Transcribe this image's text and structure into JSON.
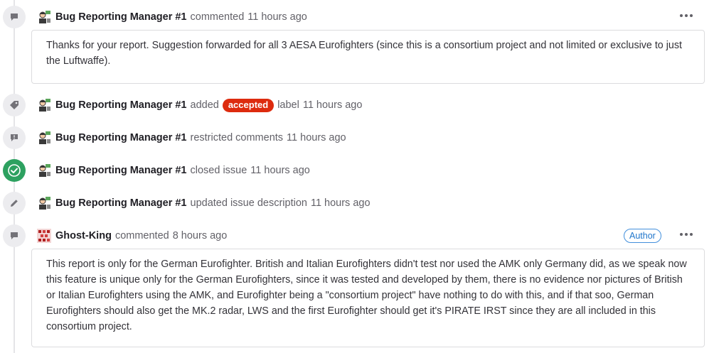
{
  "timeline": [
    {
      "type": "comment",
      "user": "Bug Reporting Manager #1",
      "action": "commented",
      "time": "11 hours ago",
      "body": "Thanks for your report. Suggestion forwarded for all 3 AESA Eurofighters (since this is a consortium project and not limited or exclusive to just the Luftwaffe)."
    },
    {
      "type": "label",
      "user": "Bug Reporting Manager #1",
      "action_before": "added",
      "label": "accepted",
      "action_after": "label",
      "time": "11 hours ago"
    },
    {
      "type": "restrict",
      "user": "Bug Reporting Manager #1",
      "action": "restricted comments",
      "time": "11 hours ago"
    },
    {
      "type": "close",
      "user": "Bug Reporting Manager #1",
      "action": "closed issue",
      "time": "11 hours ago"
    },
    {
      "type": "edit",
      "user": "Bug Reporting Manager #1",
      "action": "updated issue description",
      "time": "11 hours ago"
    },
    {
      "type": "comment",
      "user": "Ghost-King",
      "action": "commented",
      "time": "8 hours ago",
      "badge": "Author",
      "body": "This report is only for the German Eurofighter. British and Italian Eurofighters didn't test nor used the AMK only Germany did, as we speak now this feature is unique only for the German Eurofighters, since it was tested and developed by them, there is no evidence nor pictures of British or Italian Eurofighters using the AMK, and Eurofighter being a \"consortium project\" have nothing to do with this, and if that soo, German Eurofighters should also get the MK.2 radar, LWS and the first Eurofighter should get it's PIRATE IRST since they are all included in this consortium project."
    }
  ],
  "icons": {
    "comment": "comment-icon",
    "label": "label-tag-icon",
    "restrict": "restricted-comment-icon",
    "close": "check-circle-icon",
    "edit": "pencil-icon",
    "more": "more-actions-icon"
  },
  "colors": {
    "label_accepted": "#dd2b0e",
    "closed_success": "#2da160",
    "author_badge": "#1f75cb"
  }
}
